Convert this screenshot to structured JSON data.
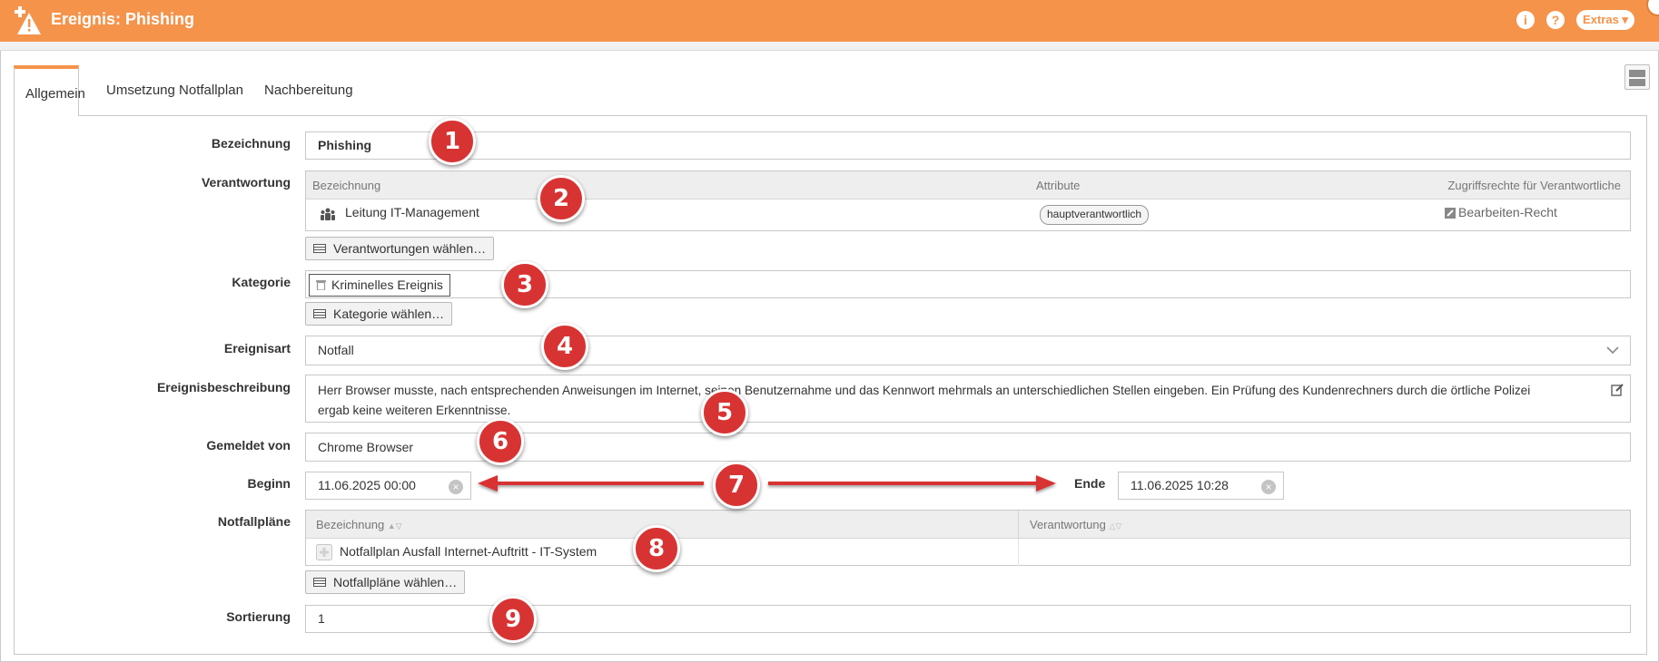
{
  "header": {
    "title": "Ereignis: Phishing",
    "info_icon": "i",
    "help_icon": "?",
    "extras_label": "Extras ▾",
    "color": "#f5934b"
  },
  "tabs": [
    {
      "label": "Allgemein",
      "active": true
    },
    {
      "label": "Umsetzung Notfallplan",
      "active": false
    },
    {
      "label": "Nachbereitung",
      "active": false
    }
  ],
  "form": {
    "bezeichnung_label": "Bezeichnung",
    "bezeichnung_value": "Phishing",
    "verantwortung_label": "Verantwortung",
    "verantwortung_table": {
      "headers": [
        "Bezeichnung",
        "Attribute",
        "Zugriffsrechte für Verantwortliche"
      ],
      "row": {
        "name": "Leitung IT-Management",
        "attribute": "hauptverantwortlich",
        "right": "Bearbeiten-Recht"
      }
    },
    "verantwortung_button": "Verantwortungen wählen…",
    "kategorie_label": "Kategorie",
    "kategorie_tag": "Kriminelles Ereignis",
    "kategorie_button": "Kategorie wählen…",
    "ereignisart_label": "Ereignisart",
    "ereignisart_value": "Notfall",
    "beschreibung_label": "Ereignisbeschreibung",
    "beschreibung_line1": "Herr Browser musste, nach entsprechenden Anweisungen im Internet, seinen Benutzernahme und das Kennwort mehrmals an unterschiedlichen Stellen eingeben. Ein Prüfung des Kundenrechners durch die örtliche Polizei",
    "beschreibung_line2": "ergab keine weiteren Erkenntnisse.",
    "gemeldet_label": "Gemeldet von",
    "gemeldet_value": "Chrome Browser",
    "beginn_label": "Beginn",
    "beginn_value": "11.06.2025 00:00",
    "ende_label": "Ende",
    "ende_value": "11.06.2025 10:28",
    "notfallplaene_label": "Notfallpläne",
    "notfallplaene_table": {
      "headers": [
        "Bezeichnung",
        "Verantwortung"
      ],
      "row": {
        "name": "Notfallplan Ausfall Internet-Auftritt - IT-System",
        "responsible": ""
      }
    },
    "notfallplaene_button": "Notfallpläne wählen…",
    "sortierung_label": "Sortierung",
    "sortierung_value": "1"
  },
  "annotations": [
    "1",
    "2",
    "3",
    "4",
    "5",
    "6",
    "7",
    "8",
    "9"
  ],
  "annotation_color": "#d83333"
}
